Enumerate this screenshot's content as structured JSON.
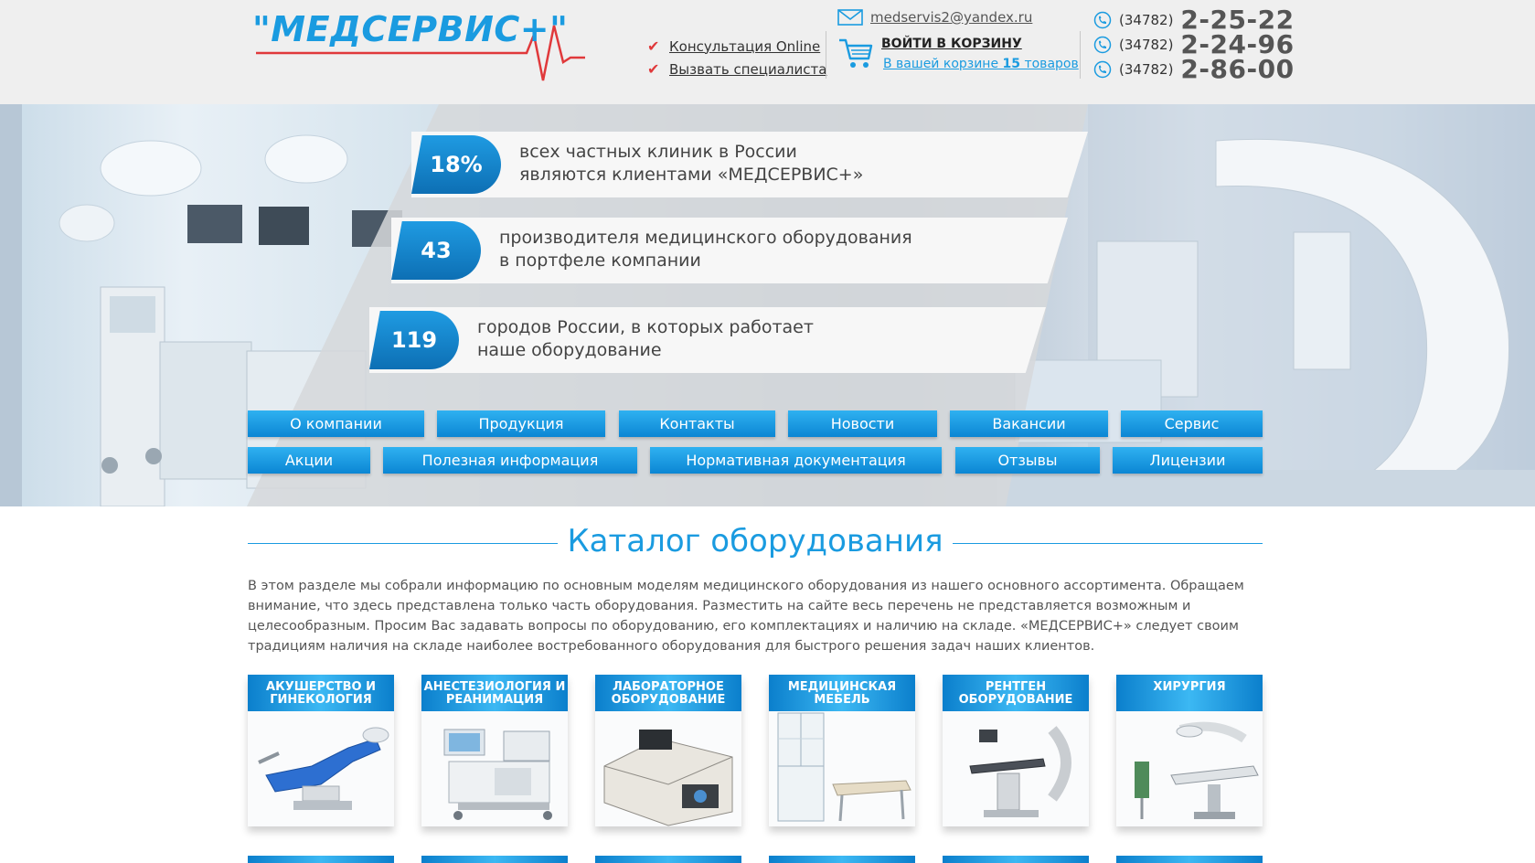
{
  "header": {
    "logo_text": "\"МЕДСЕРВИС+\"",
    "consult_links": [
      "Консультация Online",
      "Вызвать специалиста"
    ],
    "email": "medservis2@yandex.ru",
    "cart_title": "ВОЙТИ В КОРЗИНУ",
    "cart_prefix": "В вашей корзине ",
    "cart_count": "15",
    "cart_suffix": " товаров",
    "phones": [
      {
        "code": "(34782)",
        "number": "2-25-22"
      },
      {
        "code": "(34782)",
        "number": "2-24-96"
      },
      {
        "code": "(34782)",
        "number": "2-86-00"
      }
    ]
  },
  "stats": [
    {
      "value": "18%",
      "text": "всех частных клиник в России\nявляются клиентами «МЕДСЕРВИС+»"
    },
    {
      "value": "43",
      "text": "производителя медицинского оборудования\nв портфеле компании"
    },
    {
      "value": "119",
      "text": "городов России, в которых работает\nнаше оборудование"
    }
  ],
  "nav": {
    "row1": [
      "О компании",
      "Продукция",
      "Контакты",
      "Новости",
      "Вакансии",
      "Сервис"
    ],
    "row2": [
      "Акции",
      "Полезная информация",
      "Нормативная документация",
      "Отзывы",
      "Лицензии"
    ]
  },
  "catalog": {
    "title": "Каталог оборудования",
    "intro": "В этом разделе мы собрали информацию по основным моделям медицинского оборудования из нашего основного ассортимента. Обращаем внимание, что здесь представлена только часть оборудования. Разместить на сайте весь перечень не представляется возможным и целесообразным. Просим Вас задавать вопросы по оборудованию, его комплектациях и наличию на складе. «МЕДСЕРВИС+» следует своим традициям наличия на складе наиболее востребованного оборудования для быстрого решения задач наших клиентов.",
    "categories": [
      {
        "label": "АКУШЕРСТВО И ГИНЕКОЛОГИЯ",
        "icon": "gynecology-chair-icon"
      },
      {
        "label": "АНЕСТЕЗИОЛОГИЯ И РЕАНИМАЦИЯ",
        "icon": "anesthesia-machine-icon"
      },
      {
        "label": "ЛАБОРАТОРНОЕ ОБОРУДОВАНИЕ",
        "icon": "lab-analyzer-icon"
      },
      {
        "label": "МЕДИЦИНСКАЯ МЕБЕЛЬ",
        "icon": "medical-furniture-icon"
      },
      {
        "label": "РЕНТГЕН ОБОРУДОВАНИЕ",
        "icon": "xray-machine-icon"
      },
      {
        "label": "ХИРУРГИЯ",
        "icon": "surgery-table-icon"
      }
    ]
  },
  "colors": {
    "accent": "#1a9be0",
    "nav_top": "#2fb1f1",
    "nav_bottom": "#0b86d4",
    "check": "#e0393b",
    "header_bg": "#efefef"
  }
}
